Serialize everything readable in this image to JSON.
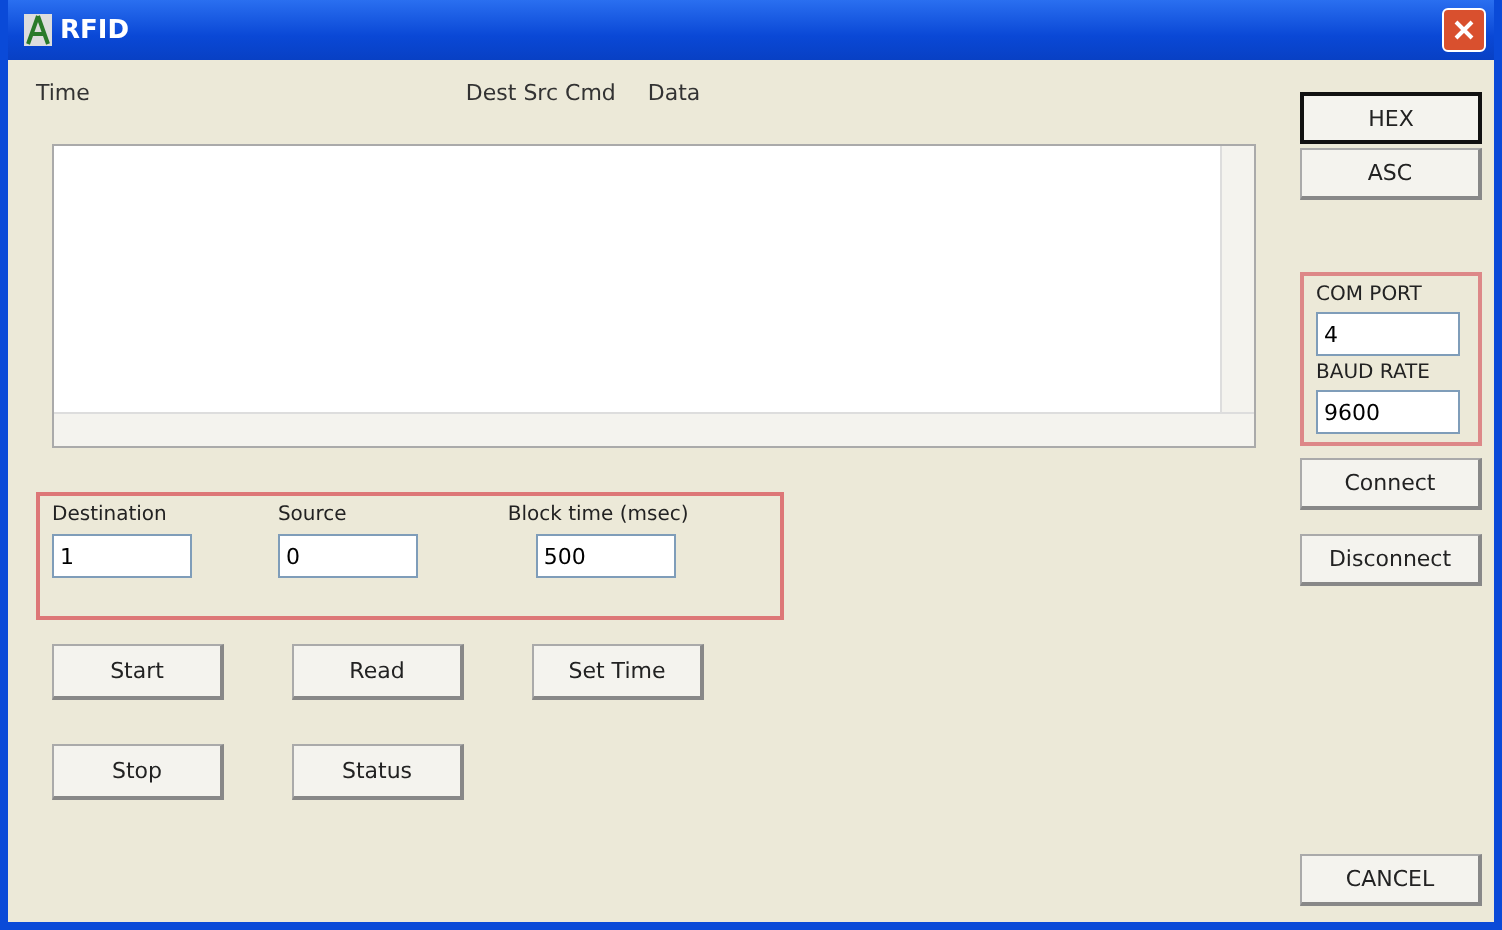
{
  "window": {
    "title": "RFID"
  },
  "list": {
    "headers": [
      "Time",
      "Dest Src Cmd",
      "Data"
    ]
  },
  "fields": [
    {
      "label": "Destination",
      "value": "1"
    },
    {
      "label": "Source",
      "value": "0"
    },
    {
      "label": "Block time (msec)",
      "value": "500"
    }
  ],
  "action_buttons": [
    [
      "Start",
      "Read",
      "Set Time"
    ],
    [
      "Stop",
      "Status"
    ]
  ],
  "mode_buttons": [
    {
      "label": "HEX",
      "selected": true
    },
    {
      "label": "ASC",
      "selected": false
    }
  ],
  "port": {
    "com_label": "COM PORT",
    "com_value": "4",
    "baud_label": "BAUD RATE",
    "baud_value": "9600"
  },
  "side_buttons": [
    "Connect",
    "Disconnect"
  ],
  "bottom_button": "CANCEL"
}
